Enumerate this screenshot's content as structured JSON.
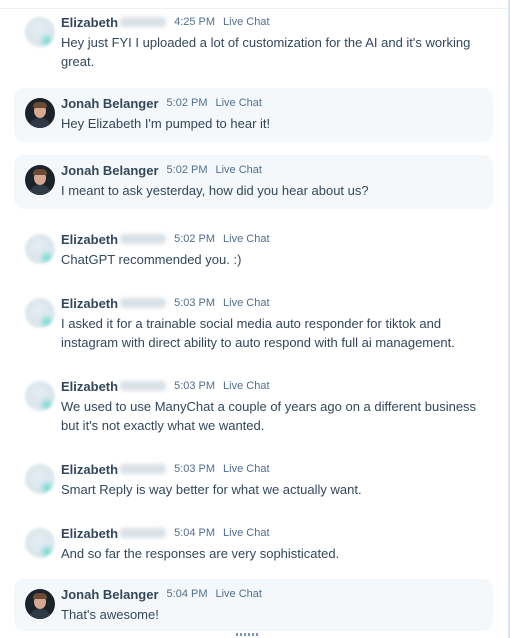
{
  "thread": {
    "messages": [
      {
        "sender": "Elizabeth",
        "role": "visitor",
        "time": "4:25 PM",
        "channel": "Live Chat",
        "text": "Hey just FYI I uploaded a lot of customization for the AI and it's working great."
      },
      {
        "sender": "Jonah Belanger",
        "role": "agent",
        "time": "5:02 PM",
        "channel": "Live Chat",
        "text": "Hey Elizabeth I'm pumped to hear it!"
      },
      {
        "sender": "Jonah Belanger",
        "role": "agent",
        "time": "5:02 PM",
        "channel": "Live Chat",
        "text": "I meant to ask yesterday, how did you hear about us?"
      },
      {
        "sender": "Elizabeth",
        "role": "visitor",
        "time": "5:02 PM",
        "channel": "Live Chat",
        "text": "ChatGPT recommended you. :)"
      },
      {
        "sender": "Elizabeth",
        "role": "visitor",
        "time": "5:03 PM",
        "channel": "Live Chat",
        "text": "I asked it for a trainable social media auto responder for tiktok and instagram with direct ability to auto respond with full ai management."
      },
      {
        "sender": "Elizabeth",
        "role": "visitor",
        "time": "5:03 PM",
        "channel": "Live Chat",
        "text": "We used to use ManyChat a couple of years ago on a different business but it's not exactly what we wanted."
      },
      {
        "sender": "Elizabeth",
        "role": "visitor",
        "time": "5:03 PM",
        "channel": "Live Chat",
        "text": "Smart Reply is way better for what we actually want."
      },
      {
        "sender": "Elizabeth",
        "role": "visitor",
        "time": "5:04 PM",
        "channel": "Live Chat",
        "text": "And so far the responses are very sophisticated."
      },
      {
        "sender": "Jonah Belanger",
        "role": "agent",
        "time": "5:04 PM",
        "channel": "Live Chat",
        "text": "That's awesome!"
      }
    ]
  }
}
